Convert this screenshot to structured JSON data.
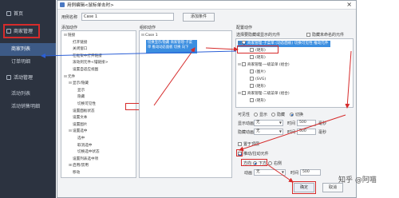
{
  "sidebar": {
    "home": "首页",
    "merchant_mgmt": "商家管理",
    "merchant_list": "商家列表",
    "order_detail": "订单明细",
    "activity_mgmt": "活动管理",
    "activity_list": "活动列表",
    "activity_sales": "活动销售明细"
  },
  "dialog": {
    "title": "用例编辑<鼠标单击时>",
    "case_name_label": "用例名称",
    "case_name_value": "Case 1",
    "add_condition": "添加条件",
    "add_action_title": "添加动作",
    "organize_action_title": "组织动作",
    "config_action_title": "配置动作",
    "choose_widget_label": "选择要隐藏或显示的元件",
    "hide_unnamed": "隐藏未命名的元件",
    "ok": "确定",
    "cancel": "取消"
  },
  "add_action_tree": [
    {
      "label": "链接",
      "level": 0,
      "toggle": "⊟"
    },
    {
      "label": "打开链接",
      "level": 1
    },
    {
      "label": "关闭窗口",
      "level": 1
    },
    {
      "label": "在框架中打开链接",
      "level": 1
    },
    {
      "label": "滚动到元件<锚链接>",
      "level": 1
    },
    {
      "label": "设置自适应视图",
      "level": 1
    },
    {
      "label": "元件",
      "level": 0,
      "toggle": "⊟"
    },
    {
      "label": "显示/隐藏",
      "level": 1,
      "toggle": "⊟"
    },
    {
      "label": "显示",
      "level": 2
    },
    {
      "label": "隐藏",
      "level": 2
    },
    {
      "label": "切换可见性",
      "level": 2
    },
    {
      "label": "设置面板状态",
      "level": 1
    },
    {
      "label": "设置文本",
      "level": 1
    },
    {
      "label": "设置图片",
      "level": 1
    },
    {
      "label": "设置选中",
      "level": 1,
      "toggle": "⊟"
    },
    {
      "label": "选中",
      "level": 2
    },
    {
      "label": "取消选中",
      "level": 2
    },
    {
      "label": "切换选中状态",
      "level": 2
    },
    {
      "label": "设置列表选中项",
      "level": 1
    },
    {
      "label": "启用/禁用",
      "level": 1,
      "toggle": "⊞"
    },
    {
      "label": "移动",
      "level": 1
    }
  ],
  "organize": {
    "case": "Case 1",
    "action": "切换显示/隐藏 商家管理-子菜单 推动动态面板 切换 向下"
  },
  "config_tree": [
    {
      "label": "商家管理-子菜单 (动态面板) 切换可见性 推动元件",
      "level": 1,
      "checked": true
    },
    {
      "label": "(矩形)",
      "level": 2,
      "checked": false
    },
    {
      "label": "(矩形)",
      "level": 2,
      "checked": false
    },
    {
      "label": "商家管理-一级菜单 (组合)",
      "level": 1,
      "checked": false
    },
    {
      "label": "(图片)",
      "level": 2,
      "checked": false
    },
    {
      "label": "(SVG)",
      "level": 2,
      "checked": false
    },
    {
      "label": "(矩形)",
      "level": 2,
      "checked": false
    },
    {
      "label": "商家管理-二级菜单 (组合)",
      "level": 1,
      "checked": false
    },
    {
      "label": "(矩形)",
      "level": 2,
      "checked": false
    }
  ],
  "config": {
    "visibility_label": "可见性",
    "show": "显示",
    "hide": "隐藏",
    "toggle": "切换",
    "show_anim_label": "显示动画",
    "hide_anim_label": "隐藏动画",
    "anim_value": "无",
    "time_label": "时间",
    "time_value": "500",
    "ms": "毫秒",
    "bring_front": "置于顶层",
    "push_widgets": "推动/拉动元件",
    "direction_label": "方向",
    "dir_down": "下方",
    "dir_right": "右侧",
    "anim2_label": "动画",
    "anim2_value": "无",
    "time2_label": "时间",
    "time2_value": "500"
  },
  "watermark": "知乎 @阿喵"
}
